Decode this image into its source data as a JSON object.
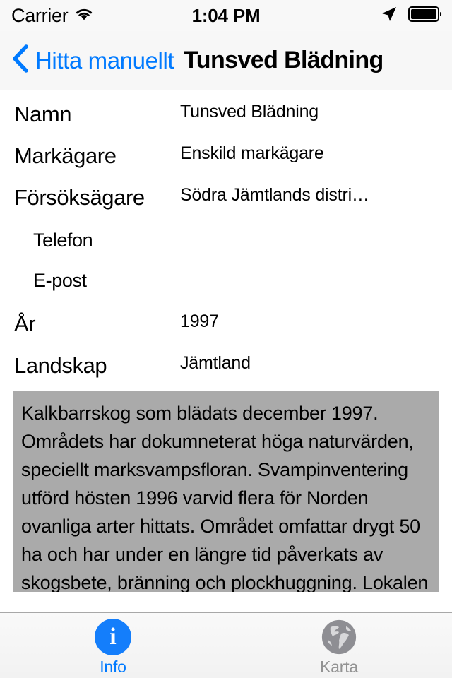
{
  "status_bar": {
    "carrier": "Carrier",
    "wifi_icon": "wifi-icon",
    "time": "1:04 PM",
    "location_icon": "location-arrow-icon",
    "battery_icon": "battery-full-icon"
  },
  "nav_bar": {
    "back_icon": "chevron-left-icon",
    "back_label": "Hitta manuellt",
    "title": "Tunsved Blädning",
    "tint_color": "#007aff"
  },
  "info_rows": [
    {
      "label": "Namn",
      "value": "Tunsved Blädning",
      "indent": false
    },
    {
      "label": "Markägare",
      "value": "Enskild markägare",
      "indent": false
    },
    {
      "label": "Försöksägare",
      "value": "Södra Jämtlands distri…",
      "indent": false
    },
    {
      "label": "Telefon",
      "value": "",
      "indent": true
    },
    {
      "label": "E-post",
      "value": "",
      "indent": true
    },
    {
      "label": "År",
      "value": "1997",
      "indent": false
    },
    {
      "label": "Landskap",
      "value": "Jämtland",
      "indent": false
    }
  ],
  "description": {
    "background_color": "#aaaaaa",
    "text": "Kalkbarrskog som blädats december 1997. Områdets har dokumneterat höga naturvärden, speciellt marksvampsfloran. Svampinventering utförd hösten 1996 varvid flera för Norden ovanliga arter hittats. Området omfattar drygt 50 ha och har under en längre tid påverkats av skogsbete, bränning och plockhuggning. Lokalen är"
  },
  "tab_bar": {
    "tabs": [
      {
        "label": "Info",
        "icon": "info-circle-icon",
        "active": true,
        "color": "#007aff"
      },
      {
        "label": "Karta",
        "icon": "globe-icon",
        "active": false,
        "color": "#929292"
      }
    ]
  }
}
